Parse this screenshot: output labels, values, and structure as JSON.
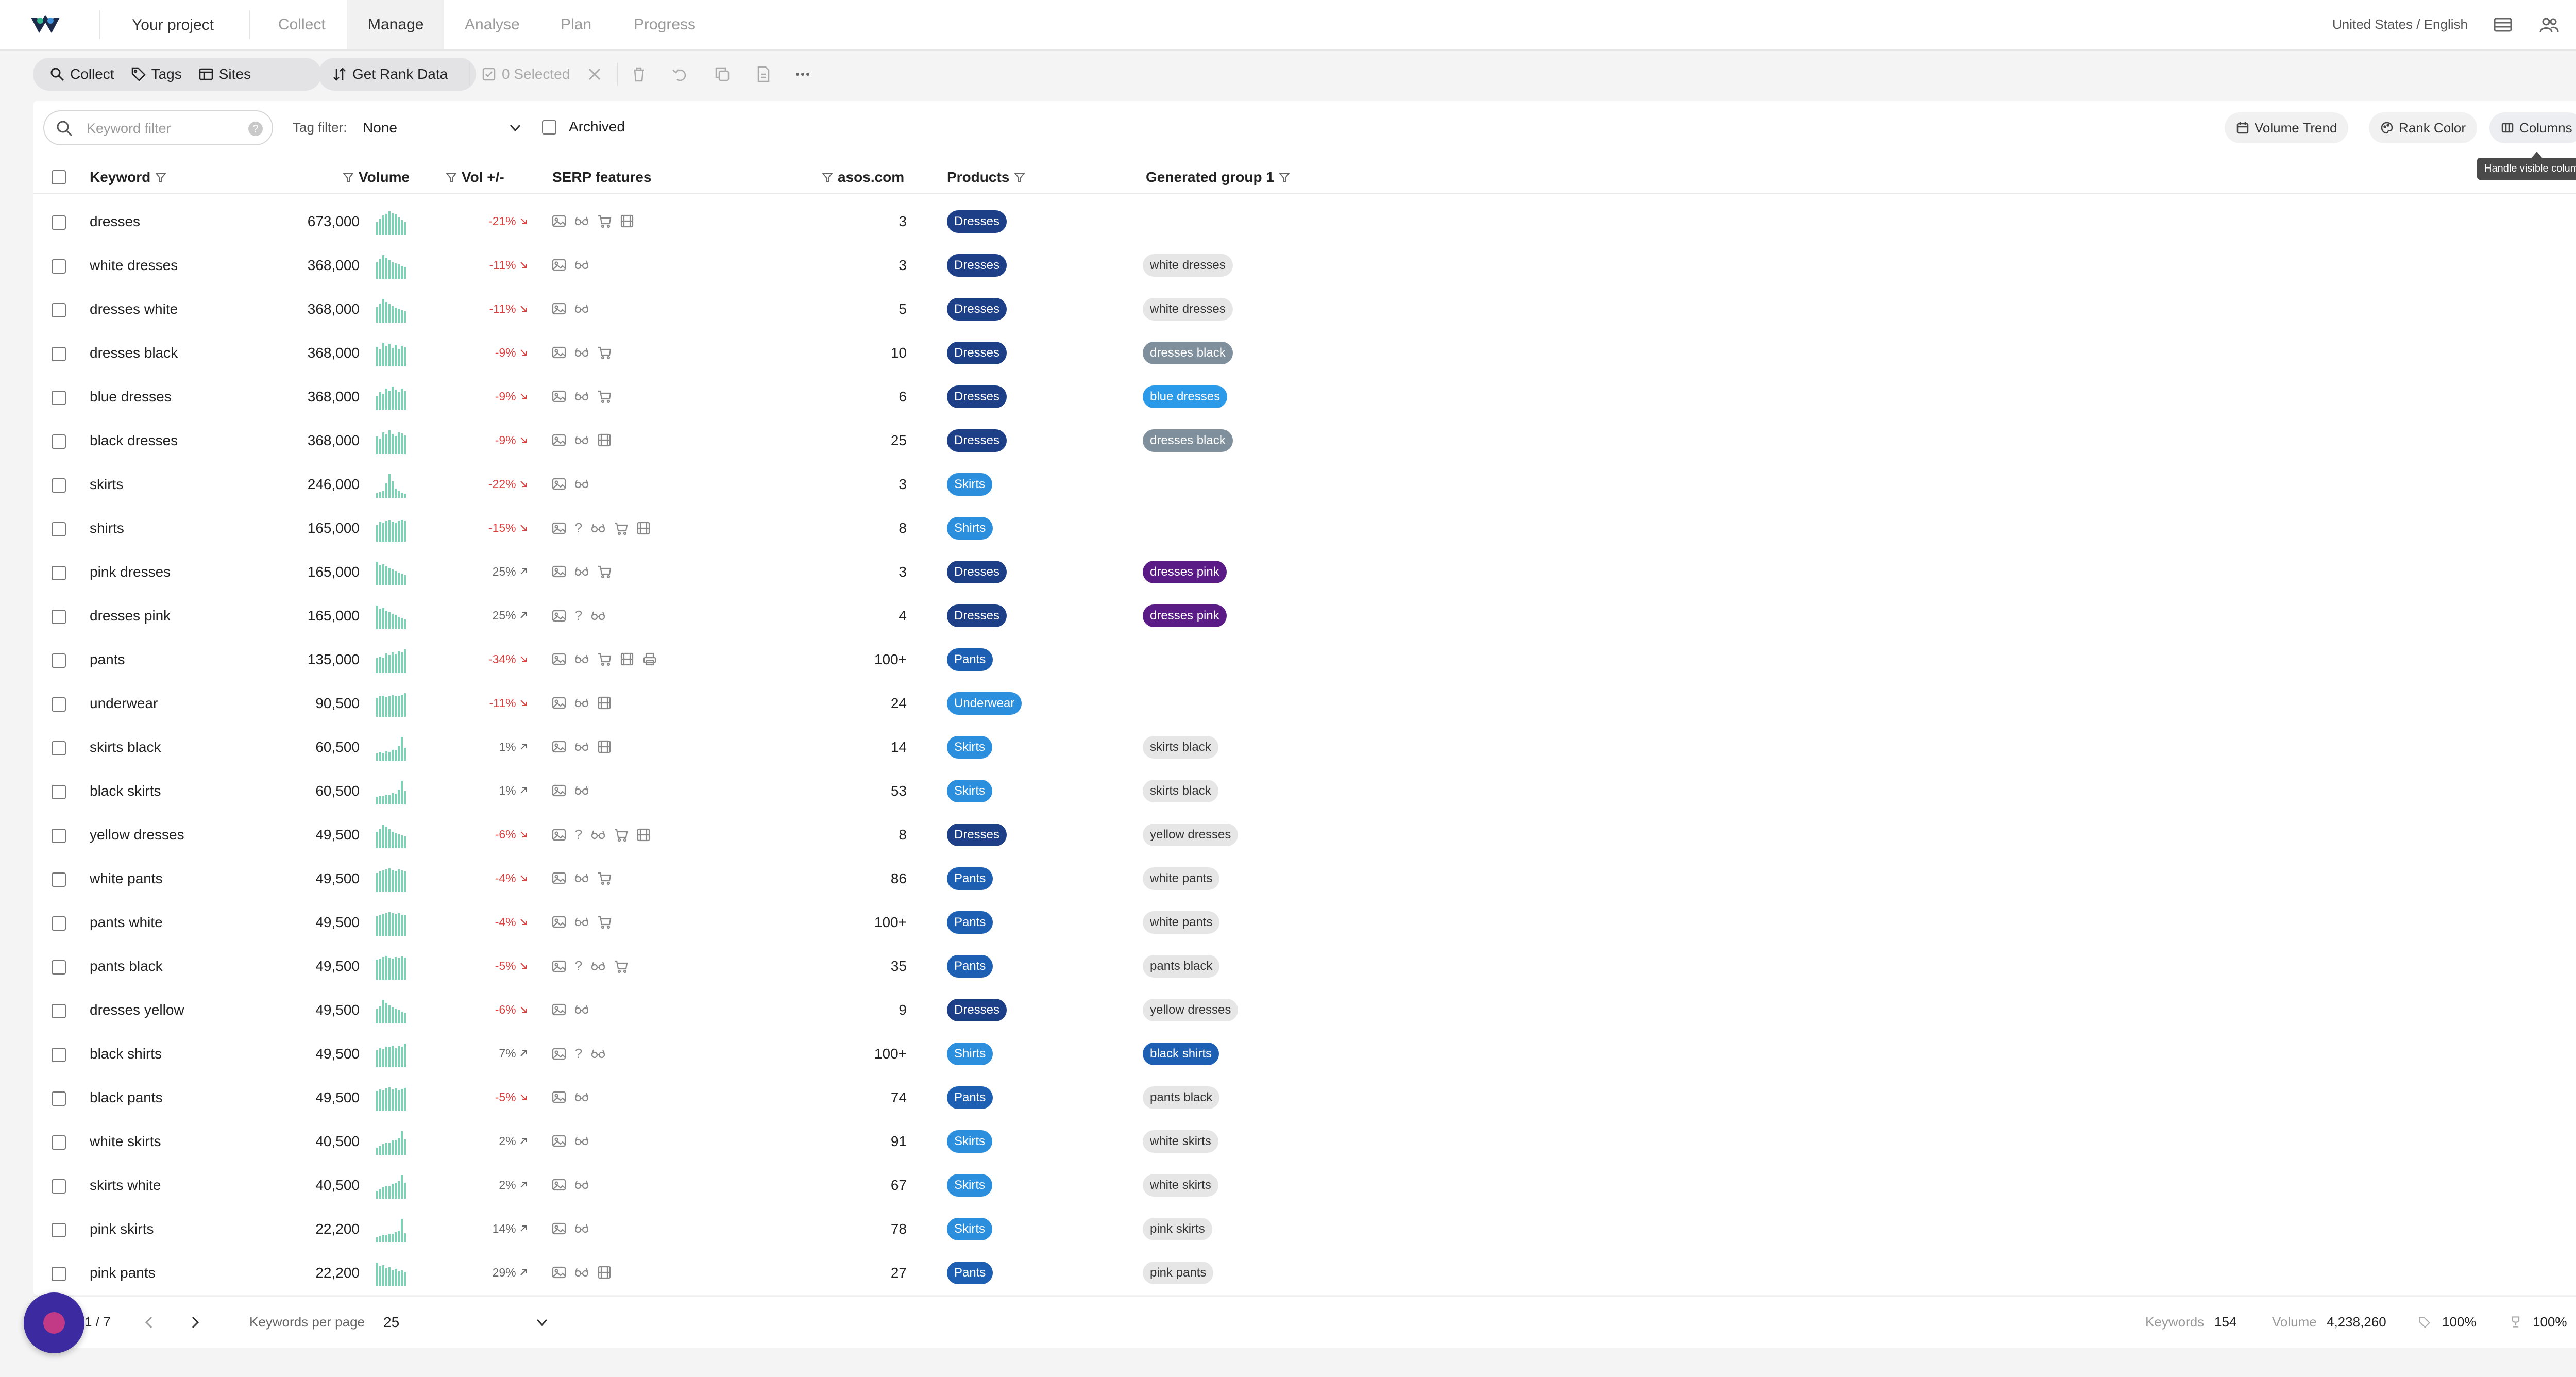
{
  "topbar": {
    "project": "Your project",
    "tabs": [
      {
        "label": "Collect",
        "active": false
      },
      {
        "label": "Manage",
        "active": true
      },
      {
        "label": "Analyse",
        "active": false
      },
      {
        "label": "Plan",
        "active": false
      },
      {
        "label": "Progress",
        "active": false
      }
    ],
    "locale": "United States / English"
  },
  "toolbar": {
    "collect": "Collect",
    "tags": "Tags",
    "sites": "Sites",
    "get_rank_data": "Get Rank Data",
    "selected": "0 Selected"
  },
  "filters": {
    "keyword_placeholder": "Keyword filter",
    "help": "?",
    "tag_filter_label": "Tag filter:",
    "tag_filter_value": "None",
    "archived": "Archived",
    "volume_trend": "Volume Trend",
    "rank_color": "Rank Color",
    "columns": "Columns",
    "columns_tooltip": "Handle visible columns"
  },
  "table": {
    "headers": {
      "keyword": "Keyword",
      "volume": "Volume",
      "vol_change": "Vol +/-",
      "serp": "SERP features",
      "site": "asos.com",
      "products": "Products",
      "group": "Generated group 1"
    },
    "colors": {
      "Dresses": "#1d3f87",
      "Skirts": "#2b8fdd",
      "Shirts": "#2b8fdd",
      "Pants": "#1c5fb3",
      "Underwear": "#2b8fdd",
      "dresses pink": "#5a1b87",
      "blue dresses": "#2b9ae8",
      "black shirts": "#1c5fb3",
      "dresses black": "#7f8f9c"
    },
    "rows": [
      {
        "keyword": "dresses",
        "volume": "673,000",
        "trend": [
          55,
          70,
          82,
          90,
          100,
          92,
          86,
          74,
          64,
          55
        ],
        "delta": "-21%",
        "dir": "down",
        "serp": [
          "img",
          "glasses",
          "cart",
          "film"
        ],
        "rank": "3",
        "product": "Dresses",
        "group": ""
      },
      {
        "keyword": "white dresses",
        "volume": "368,000",
        "trend": [
          70,
          85,
          100,
          90,
          80,
          70,
          66,
          60,
          55,
          50
        ],
        "delta": "-11%",
        "dir": "down",
        "serp": [
          "img",
          "glasses"
        ],
        "rank": "3",
        "product": "Dresses",
        "group": "white dresses"
      },
      {
        "keyword": "dresses white",
        "volume": "368,000",
        "trend": [
          65,
          80,
          100,
          88,
          78,
          70,
          62,
          58,
          52,
          48
        ],
        "delta": "-11%",
        "dir": "down",
        "serp": [
          "img",
          "glasses"
        ],
        "rank": "5",
        "product": "Dresses",
        "group": "white dresses"
      },
      {
        "keyword": "dresses black",
        "volume": "368,000",
        "trend": [
          82,
          72,
          100,
          86,
          96,
          78,
          92,
          74,
          88,
          80
        ],
        "delta": "-9%",
        "dir": "down",
        "serp": [
          "img",
          "glasses",
          "cart"
        ],
        "rank": "10",
        "product": "Dresses",
        "group": "dresses black"
      },
      {
        "keyword": "blue dresses",
        "volume": "368,000",
        "trend": [
          60,
          76,
          70,
          92,
          82,
          100,
          86,
          78,
          92,
          80
        ],
        "delta": "-9%",
        "dir": "down",
        "serp": [
          "img",
          "glasses",
          "cart"
        ],
        "rank": "6",
        "product": "Dresses",
        "group": "blue dresses"
      },
      {
        "keyword": "black dresses",
        "volume": "368,000",
        "trend": [
          74,
          66,
          92,
          82,
          100,
          84,
          76,
          92,
          86,
          78
        ],
        "delta": "-9%",
        "dir": "down",
        "serp": [
          "img",
          "glasses",
          "film"
        ],
        "rank": "25",
        "product": "Dresses",
        "group": "dresses black"
      },
      {
        "keyword": "skirts",
        "volume": "246,000",
        "trend": [
          20,
          25,
          30,
          60,
          100,
          70,
          40,
          28,
          22,
          18
        ],
        "delta": "-22%",
        "dir": "down",
        "serp": [
          "img",
          "glasses"
        ],
        "rank": "3",
        "product": "Skirts",
        "group": ""
      },
      {
        "keyword": "shirts",
        "volume": "165,000",
        "trend": [
          70,
          82,
          78,
          86,
          90,
          84,
          80,
          88,
          92,
          86
        ],
        "delta": "-15%",
        "dir": "down",
        "serp": [
          "img",
          "q",
          "glasses",
          "cart",
          "film"
        ],
        "rank": "8",
        "product": "Shirts",
        "group": ""
      },
      {
        "keyword": "pink dresses",
        "volume": "165,000",
        "trend": [
          100,
          88,
          90,
          80,
          74,
          68,
          60,
          55,
          50,
          44
        ],
        "delta": "25%",
        "dir": "up",
        "serp": [
          "img",
          "glasses",
          "cart"
        ],
        "rank": "3",
        "product": "Dresses",
        "group": "dresses pink"
      },
      {
        "keyword": "dresses pink",
        "volume": "165,000",
        "trend": [
          100,
          86,
          90,
          78,
          72,
          66,
          60,
          52,
          48,
          42
        ],
        "delta": "25%",
        "dir": "up",
        "serp": [
          "img",
          "q",
          "glasses"
        ],
        "rank": "4",
        "product": "Dresses",
        "group": "dresses pink"
      },
      {
        "keyword": "pants",
        "volume": "135,000",
        "trend": [
          62,
          70,
          66,
          82,
          76,
          86,
          80,
          92,
          86,
          100
        ],
        "delta": "-34%",
        "dir": "down",
        "serp": [
          "img",
          "glasses",
          "cart",
          "film",
          "print"
        ],
        "rank": "100+",
        "product": "Pants",
        "group": ""
      },
      {
        "keyword": "underwear",
        "volume": "90,500",
        "trend": [
          80,
          86,
          90,
          84,
          88,
          92,
          86,
          90,
          94,
          100
        ],
        "delta": "-11%",
        "dir": "down",
        "serp": [
          "img",
          "glasses",
          "film"
        ],
        "rank": "24",
        "product": "Underwear",
        "group": ""
      },
      {
        "keyword": "skirts black",
        "volume": "60,500",
        "trend": [
          30,
          36,
          32,
          40,
          38,
          46,
          44,
          60,
          100,
          54
        ],
        "delta": "1%",
        "dir": "up",
        "serp": [
          "img",
          "glasses",
          "film"
        ],
        "rank": "14",
        "product": "Skirts",
        "group": "skirts black"
      },
      {
        "keyword": "black skirts",
        "volume": "60,500",
        "trend": [
          32,
          38,
          34,
          42,
          40,
          48,
          46,
          62,
          100,
          56
        ],
        "delta": "1%",
        "dir": "up",
        "serp": [
          "img",
          "glasses"
        ],
        "rank": "53",
        "product": "Skirts",
        "group": "skirts black"
      },
      {
        "keyword": "yellow dresses",
        "volume": "49,500",
        "trend": [
          70,
          82,
          100,
          92,
          80,
          70,
          66,
          58,
          54,
          50
        ],
        "delta": "-6%",
        "dir": "down",
        "serp": [
          "img",
          "q",
          "glasses",
          "cart",
          "film"
        ],
        "rank": "8",
        "product": "Dresses",
        "group": "yellow dresses"
      },
      {
        "keyword": "white pants",
        "volume": "49,500",
        "trend": [
          80,
          88,
          92,
          96,
          100,
          94,
          90,
          96,
          92,
          88
        ],
        "delta": "-4%",
        "dir": "down",
        "serp": [
          "img",
          "glasses",
          "cart"
        ],
        "rank": "86",
        "product": "Pants",
        "group": "white pants"
      },
      {
        "keyword": "pants white",
        "volume": "49,500",
        "trend": [
          82,
          90,
          94,
          98,
          100,
          96,
          92,
          96,
          90,
          86
        ],
        "delta": "-4%",
        "dir": "down",
        "serp": [
          "img",
          "glasses",
          "cart"
        ],
        "rank": "100+",
        "product": "Pants",
        "group": "white pants"
      },
      {
        "keyword": "pants black",
        "volume": "49,500",
        "trend": [
          84,
          90,
          96,
          100,
          94,
          90,
          96,
          92,
          98,
          94
        ],
        "delta": "-5%",
        "dir": "down",
        "serp": [
          "img",
          "q",
          "glasses",
          "cart"
        ],
        "rank": "35",
        "product": "Pants",
        "group": "pants black"
      },
      {
        "keyword": "dresses yellow",
        "volume": "49,500",
        "trend": [
          60,
          74,
          100,
          88,
          76,
          68,
          62,
          56,
          50,
          46
        ],
        "delta": "-6%",
        "dir": "down",
        "serp": [
          "img",
          "glasses"
        ],
        "rank": "9",
        "product": "Dresses",
        "group": "yellow dresses"
      },
      {
        "keyword": "black shirts",
        "volume": "49,500",
        "trend": [
          72,
          82,
          76,
          88,
          84,
          92,
          80,
          90,
          86,
          100
        ],
        "delta": "7%",
        "dir": "up",
        "serp": [
          "img",
          "q",
          "glasses"
        ],
        "rank": "100+",
        "product": "Shirts",
        "group": "black shirts"
      },
      {
        "keyword": "black pants",
        "volume": "49,500",
        "trend": [
          84,
          92,
          88,
          96,
          100,
          92,
          96,
          90,
          94,
          98
        ],
        "delta": "-5%",
        "dir": "down",
        "serp": [
          "img",
          "glasses"
        ],
        "rank": "74",
        "product": "Pants",
        "group": "pants black"
      },
      {
        "keyword": "white skirts",
        "volume": "40,500",
        "trend": [
          30,
          40,
          46,
          52,
          50,
          60,
          64,
          72,
          100,
          66
        ],
        "delta": "2%",
        "dir": "up",
        "serp": [
          "img",
          "glasses"
        ],
        "rank": "91",
        "product": "Skirts",
        "group": "white skirts"
      },
      {
        "keyword": "skirts white",
        "volume": "40,500",
        "trend": [
          32,
          42,
          48,
          54,
          52,
          62,
          66,
          74,
          100,
          68
        ],
        "delta": "2%",
        "dir": "up",
        "serp": [
          "img",
          "glasses"
        ],
        "rank": "67",
        "product": "Skirts",
        "group": "white skirts"
      },
      {
        "keyword": "pink skirts",
        "volume": "22,200",
        "trend": [
          22,
          28,
          32,
          30,
          38,
          36,
          44,
          50,
          100,
          40
        ],
        "delta": "14%",
        "dir": "up",
        "serp": [
          "img",
          "glasses"
        ],
        "rank": "78",
        "product": "Skirts",
        "group": "pink skirts"
      },
      {
        "keyword": "pink pants",
        "volume": "22,200",
        "trend": [
          100,
          84,
          90,
          76,
          80,
          70,
          74,
          64,
          68,
          60
        ],
        "delta": "29%",
        "dir": "up",
        "serp": [
          "img",
          "glasses",
          "film"
        ],
        "rank": "27",
        "product": "Pants",
        "group": "pink pants"
      }
    ]
  },
  "footer": {
    "page": "1 / 7",
    "per_page_label": "Keywords per page",
    "per_page_value": "25",
    "keywords_label": "Keywords",
    "keywords_value": "154",
    "volume_label": "Volume",
    "volume_value": "4,238,260",
    "tag_pct": "100%",
    "rank_pct": "100%"
  }
}
